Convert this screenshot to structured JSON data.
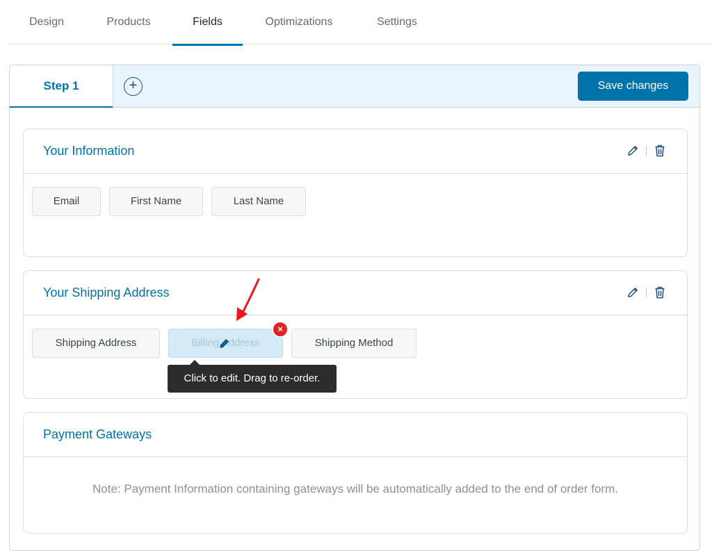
{
  "top_tabs": [
    {
      "label": "Design",
      "active": false
    },
    {
      "label": "Products",
      "active": false
    },
    {
      "label": "Fields",
      "active": true
    },
    {
      "label": "Optimizations",
      "active": false
    },
    {
      "label": "Settings",
      "active": false
    }
  ],
  "step": {
    "tab_label": "Step 1",
    "add_label": "+",
    "save_label": "Save changes"
  },
  "sections": [
    {
      "title": "Your Information",
      "fields": [
        "Email",
        "First Name",
        "Last Name"
      ]
    },
    {
      "title": "Your Shipping Address",
      "fields": [
        "Shipping Address",
        "Billing Address",
        "Shipping Method"
      ],
      "tooltip": "Click to edit. Drag to re-order.",
      "remove_label": "×"
    },
    {
      "title": "Payment Gateways",
      "note": "Note: Payment Information containing gateways will be automatically added to the end of order form."
    }
  ],
  "colors": {
    "accent": "#0073aa",
    "danger": "#e02424",
    "annotation_arrow": "#f0141e"
  },
  "icons": {
    "edit": "pencil-icon",
    "delete": "trash-icon",
    "add": "plus-circle-icon"
  }
}
